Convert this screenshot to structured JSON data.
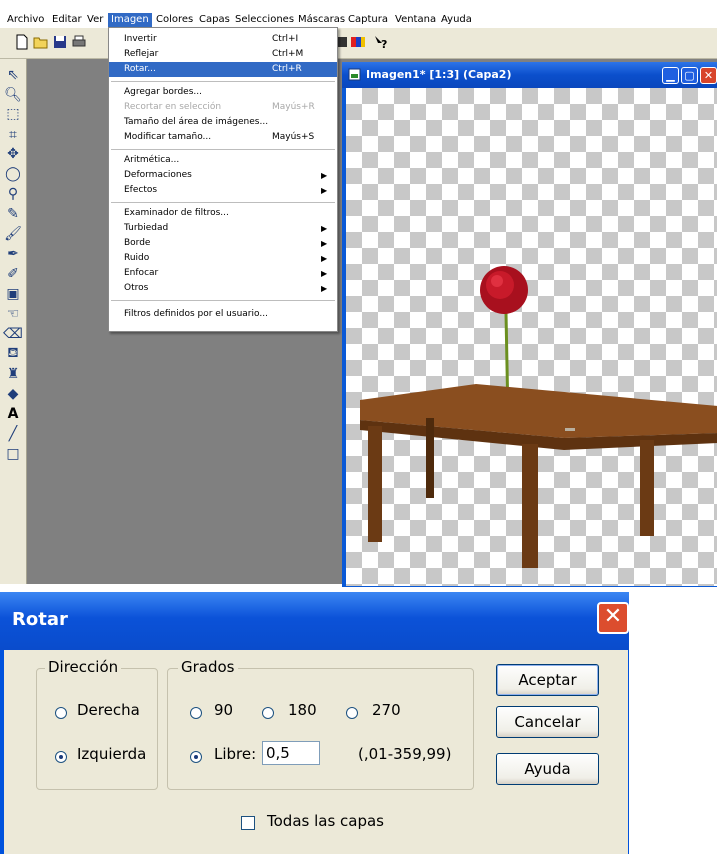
{
  "menubar": {
    "items": [
      "Archivo",
      "Editar",
      "Ver",
      "Imagen",
      "Colores",
      "Capas",
      "Selecciones",
      "Máscaras",
      "Captura",
      "Ventana",
      "Ayuda"
    ]
  },
  "dropdown": {
    "items": [
      {
        "label": "Invertir",
        "shortcut": "Ctrl+I"
      },
      {
        "label": "Reflejar",
        "shortcut": "Ctrl+M"
      },
      {
        "label": "Rotar...",
        "shortcut": "Ctrl+R"
      },
      {
        "label": "Agregar bordes..."
      },
      {
        "label": "Recortar en selección",
        "shortcut": "Mayús+R"
      },
      {
        "label": "Tamaño del área de imágenes..."
      },
      {
        "label": "Modificar tamaño...",
        "shortcut": "Mayús+S"
      },
      {
        "label": "Aritmética..."
      },
      {
        "label": "Deformaciones"
      },
      {
        "label": "Efectos"
      },
      {
        "label": "Examinador de filtros..."
      },
      {
        "label": "Turbiedad"
      },
      {
        "label": "Borde"
      },
      {
        "label": "Ruido"
      },
      {
        "label": "Enfocar"
      },
      {
        "label": "Otros"
      },
      {
        "label": "Filtros definidos por el usuario..."
      }
    ]
  },
  "image_window": {
    "title": "Imagen1* [1:3] (Capa2)"
  },
  "dialog": {
    "title": "Rotar",
    "direction": {
      "legend": "Dirección",
      "options": [
        "Derecha",
        "Izquierda"
      ],
      "selected": "Izquierda"
    },
    "degrees": {
      "legend": "Grados",
      "options": [
        "90",
        "180",
        "270"
      ],
      "free_label": "Libre:",
      "free_value": "0,5",
      "range": "(,01-359,99)"
    },
    "buttons": {
      "ok": "Aceptar",
      "cancel": "Cancelar",
      "help": "Ayuda"
    },
    "all_layers": "Todas las capas"
  },
  "colors": {
    "selection": "#316ac5",
    "titlebar": "#0b52d8",
    "close": "#dc4d2e"
  }
}
